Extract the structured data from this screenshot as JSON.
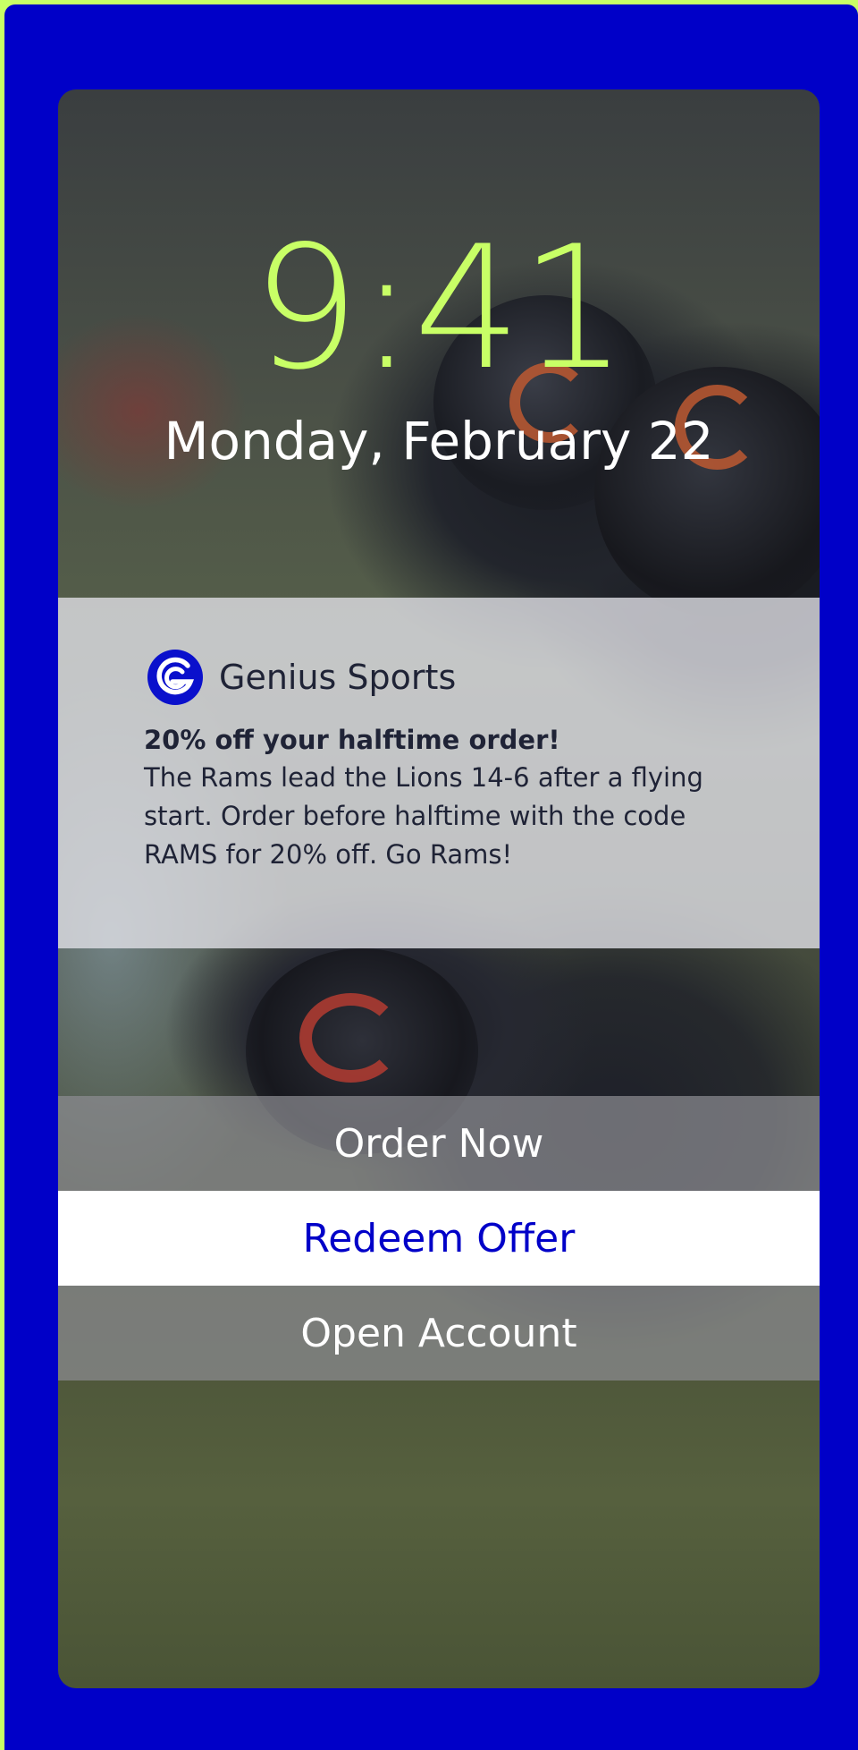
{
  "lockscreen": {
    "time": "9:41",
    "date": "Monday, February 22"
  },
  "notification": {
    "app_name": "Genius Sports",
    "app_icon": "genius-sports-logo",
    "title": "20% off your halftime order!",
    "body": "The Rams lead the Lions 14-6 after a flying start. Order before halftime with the code RAMS for 20% off. Go Rams!"
  },
  "actions": [
    {
      "label": "Order Now"
    },
    {
      "label": "Redeem Offer"
    },
    {
      "label": "Open Account"
    }
  ],
  "colors": {
    "frame": "#0000c8",
    "accent": "#c8ff66",
    "text_dark": "#1f2336",
    "primary_action_text": "#0000c8"
  }
}
